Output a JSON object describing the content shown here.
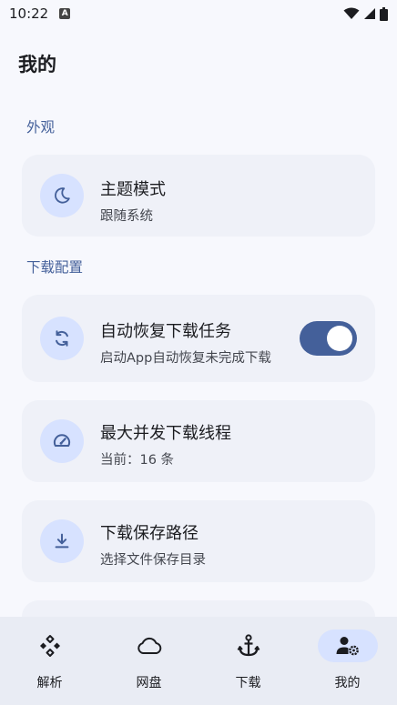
{
  "status": {
    "time": "10:22",
    "notif_letter": "A"
  },
  "page": {
    "title": "我的"
  },
  "sections": {
    "appearance": "外观",
    "download": "下载配置"
  },
  "settings": {
    "theme": {
      "title": "主题模式",
      "subtitle": "跟随系统",
      "icon": "moon-icon"
    },
    "auto_resume": {
      "title": "自动恢复下载任务",
      "subtitle": "启动App自动恢复未完成下载",
      "icon": "sync-icon",
      "enabled": true
    },
    "max_threads": {
      "title": "最大并发下载线程",
      "subtitle": "当前：16 条",
      "icon": "speedometer-icon"
    },
    "save_path": {
      "title": "下载保存路径",
      "subtitle": "选择文件保存目录",
      "icon": "download-icon"
    }
  },
  "nav": [
    {
      "label": "解析",
      "icon": "parse-icon"
    },
    {
      "label": "网盘",
      "icon": "cloud-icon"
    },
    {
      "label": "下载",
      "icon": "anchor-icon"
    },
    {
      "label": "我的",
      "icon": "user-settings-icon",
      "active": true
    }
  ],
  "colors": {
    "accent": "#44609a",
    "icon_bg": "#d7e2ff",
    "card_bg": "#eff1f8"
  }
}
